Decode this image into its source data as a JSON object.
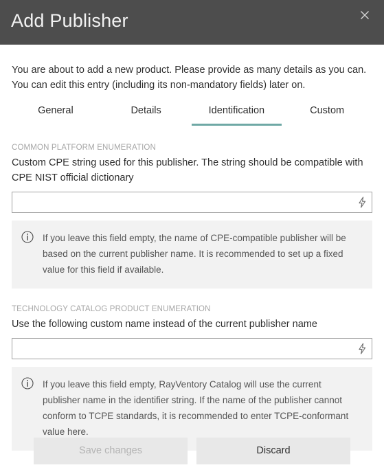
{
  "dialog": {
    "title": "Add Publisher",
    "close_icon": "close-icon"
  },
  "intro": {
    "line1": "You are about to add a new product. Please provide as many details as you can.",
    "line2": "You can edit this entry (including its non-mandatory fields) later on."
  },
  "tabs": [
    {
      "label": "General",
      "active": false
    },
    {
      "label": "Details",
      "active": false
    },
    {
      "label": "Identification",
      "active": true
    },
    {
      "label": "Custom",
      "active": false
    }
  ],
  "accent_color": "#6fa8a5",
  "sections": [
    {
      "label": "COMMON PLATFORM ENUMERATION",
      "description": "Custom CPE string used for this publisher. The string should be compatible with CPE NIST official dictionary",
      "input": {
        "value": "",
        "placeholder": "",
        "action_icon": "lightning-bolt-icon"
      },
      "info": {
        "icon": "info-circle-icon",
        "text": "If you leave this field empty, the name of CPE-compatible publisher will be based on the current publisher name. It is recommended to set up a fixed value for this field if available."
      }
    },
    {
      "label": "TECHNOLOGY CATALOG PRODUCT ENUMERATION",
      "description": "Use the following custom name instead of the current publisher name",
      "input": {
        "value": "",
        "placeholder": "",
        "action_icon": "lightning-bolt-icon"
      },
      "info": {
        "icon": "info-circle-icon",
        "text": "If you leave this field empty, RayVentory Catalog will use the current publisher name in the identifier string. If the name of the publisher cannot conform to TCPE standards, it is recommended to enter TCPE-conformant value here."
      }
    }
  ],
  "footer": {
    "save_label": "Save changes",
    "save_enabled": false,
    "discard_label": "Discard",
    "discard_enabled": true
  }
}
